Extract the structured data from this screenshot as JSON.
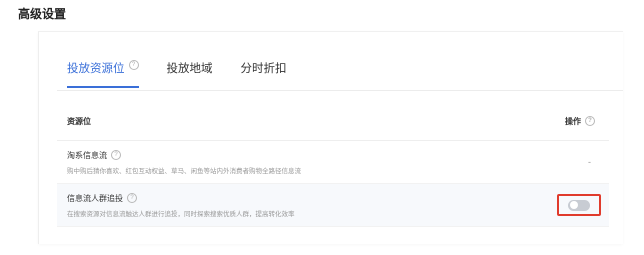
{
  "page": {
    "title": "高级设置"
  },
  "tabs": [
    {
      "label": "投放资源位",
      "active": true,
      "has_help": true
    },
    {
      "label": "投放地域",
      "active": false,
      "has_help": false
    },
    {
      "label": "分时折扣",
      "active": false,
      "has_help": false
    }
  ],
  "table": {
    "col_resource": "资源位",
    "col_operation": "操作",
    "rows": [
      {
        "name": "淘系信息流",
        "description": "购中购后猜你喜欢、红包互动权益、草马、闲鱼等站内外消费者购物全路径信息流",
        "operation": "-"
      },
      {
        "name": "信息流人群追投",
        "description": "在搜索资源对信息流触达人群进行追投，同时探索搜索优质人群，提高转化效率",
        "toggle": "off"
      }
    ]
  },
  "colors": {
    "accent": "#3a6fd8",
    "highlight_border": "#e03b2c"
  },
  "icons": {
    "help": "question-circle-icon"
  }
}
